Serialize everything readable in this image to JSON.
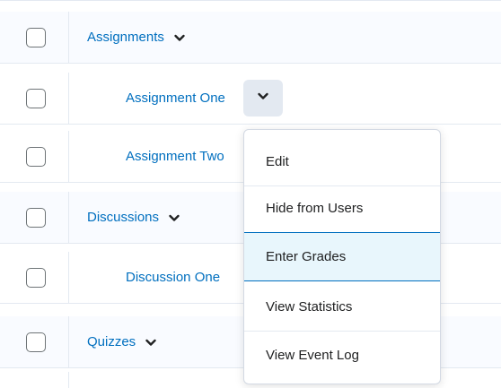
{
  "rows": [
    {
      "label": "Assignments",
      "level": 1,
      "has_chevron": true
    },
    {
      "label": "Assignment One",
      "level": 2,
      "has_chevron": true,
      "chevron_active": true
    },
    {
      "label": "Assignment Two",
      "level": 2,
      "has_chevron": false
    },
    {
      "label": "Discussions",
      "level": 1,
      "has_chevron": true
    },
    {
      "label": "Discussion One",
      "level": 2,
      "has_chevron": false
    },
    {
      "label": "Quizzes",
      "level": 1,
      "has_chevron": true
    }
  ],
  "context_menu": {
    "items": [
      {
        "label": "Edit"
      },
      {
        "label": "Hide from Users"
      },
      {
        "label": "Enter Grades",
        "active": true
      },
      {
        "label": "View Statistics"
      },
      {
        "label": "View Event Log"
      }
    ]
  },
  "colors": {
    "link": "#006fbf",
    "row_shade": "#f9fbff",
    "border": "#e3e9f1",
    "menu_active_bg": "#e8f6fc",
    "menu_active_border": "#006fbf"
  },
  "icons": {
    "chevron": "chevron-down-icon"
  }
}
